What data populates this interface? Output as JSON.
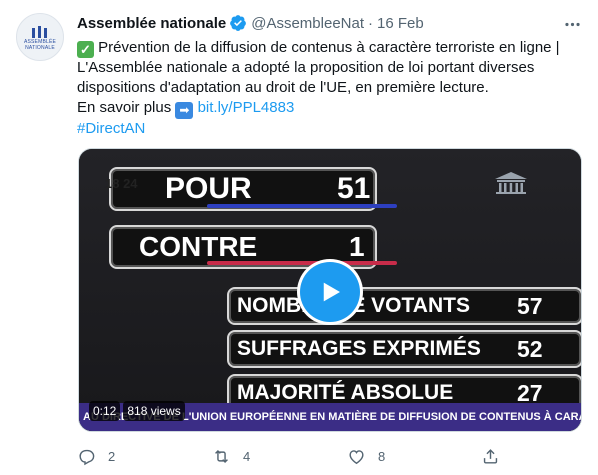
{
  "account": {
    "name": "Assemblée nationale",
    "handle": "@AssembleeNat",
    "separator": "·",
    "date": "16 Feb",
    "avatar_text_line1": "ASSEMBLÉE",
    "avatar_text_line2": "NATIONALE"
  },
  "tweet": {
    "line1": "Prévention de la diffusion de contenus à caractère terroriste en ligne |",
    "line2": "L'Assemblée nationale a adopté la proposition de loi portant diverses",
    "line3": "dispositions d'adaptation au droit de l'UE, en première lecture.",
    "more_prefix": "En savoir plus",
    "link": "bit.ly/PPL4883",
    "hashtag": "#DirectAN"
  },
  "video": {
    "overlay_time": "18 24",
    "pour_label": "POUR",
    "pour_value": "51",
    "contre_label": "CONTRE",
    "contre_value": "1",
    "votants_label": "NOMBRE DE VOTANTS",
    "votants_value": "57",
    "suffrages_label": "SUFFRAGES EXPRIMÉS",
    "suffrages_value": "52",
    "majorite_label": "MAJORITÉ ABSOLUE",
    "majorite_value": "27",
    "ticker": "AU DIRECTIVE DE L'UNION EUROPÉENNE  EN MATIÈRE DE DIFFUSION DE CONTENUS À CARACTÈRE",
    "elapsed": "0:12",
    "views": "818 views"
  },
  "actions": {
    "replies": "2",
    "retweets": "4",
    "likes": "8"
  },
  "colors": {
    "accent": "#1d9bf0",
    "ticker": "#3b2d86",
    "text_secondary": "#536471"
  }
}
